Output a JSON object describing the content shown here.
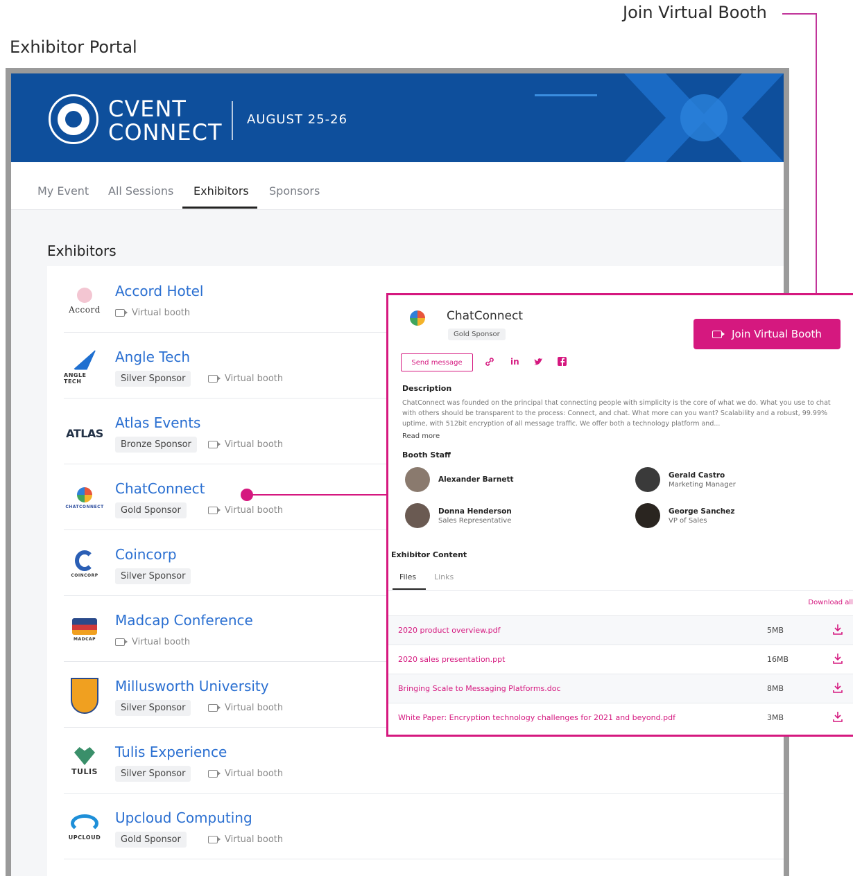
{
  "annotations": {
    "portal_title": "Exhibitor Portal",
    "callout": "Join Virtual Booth"
  },
  "banner": {
    "brand_line1": "CVENT",
    "brand_line2": "CONNECT",
    "date": "AUGUST 25-26"
  },
  "nav": {
    "tabs": [
      "My Event",
      "All Sessions",
      "Exhibitors",
      "Sponsors"
    ],
    "active": "Exhibitors"
  },
  "section_title": "Exhibitors",
  "virtual_booth_label": "Virtual booth",
  "exhibitors": [
    {
      "name": "Accord Hotel",
      "sponsor": "",
      "logo_text": "Accord",
      "color": "#d8869a"
    },
    {
      "name": "Angle Tech",
      "sponsor": "Silver Sponsor",
      "logo_text": "ANGLE TECH",
      "color": "#1e6fd0"
    },
    {
      "name": "Atlas Events",
      "sponsor": "Bronze Sponsor",
      "logo_text": "ATLAS",
      "color": "#233247"
    },
    {
      "name": "ChatConnect",
      "sponsor": "Gold Sponsor",
      "logo_text": "CHATCONNECT",
      "color": "#e8553b"
    },
    {
      "name": "Coincorp",
      "sponsor": "Silver Sponsor",
      "logo_text": "COINCORP",
      "color": "#2b5fb5"
    },
    {
      "name": "Madcap Conference",
      "sponsor": "",
      "logo_text": "MADCAP",
      "color": "#d03a3a"
    },
    {
      "name": "Millusworth University",
      "sponsor": "Silver Sponsor",
      "logo_text": "",
      "color": "#f0a020"
    },
    {
      "name": "Tulis Experience",
      "sponsor": "Silver Sponsor",
      "logo_text": "TULIS",
      "color": "#3a8f6a"
    },
    {
      "name": "Upcloud Computing",
      "sponsor": "Gold Sponsor",
      "logo_text": "UPCLOUD",
      "color": "#1e8fd8"
    }
  ],
  "panel": {
    "name": "ChatConnect",
    "badge": "Gold Sponsor",
    "join_button": "Join Virtual Booth",
    "send_message": "Send message",
    "social": [
      "link-icon",
      "linkedin-icon",
      "twitter-icon",
      "facebook-icon"
    ],
    "description_label": "Description",
    "description": "ChatConnect was founded on the principal that connecting people with simplicity is the core of what we do. What you use to chat with others should be transparent to the process: Connect, and chat. What more can you want? Scalability and a robust, 99.99% uptime, with 512bit encryption of all message traffic. We offer both a technology platform and...",
    "read_more": "Read more",
    "staff_label": "Booth Staff",
    "staff": [
      {
        "name": "Alexander Barnett",
        "title": ""
      },
      {
        "name": "Gerald Castro",
        "title": "Marketing Manager"
      },
      {
        "name": "Donna Henderson",
        "title": "Sales Representative"
      },
      {
        "name": "George Sanchez",
        "title": "VP of Sales"
      }
    ],
    "content_label": "Exhibitor Content",
    "content_tabs": [
      "Files",
      "Links"
    ],
    "download_all": "Download all",
    "files": [
      {
        "name": "2020 product overview.pdf",
        "size": "5MB"
      },
      {
        "name": "2020 sales presentation.ppt",
        "size": "16MB"
      },
      {
        "name": "Bringing Scale to Messaging Platforms.doc",
        "size": "8MB"
      },
      {
        "name": "White Paper: Encryption technology challenges for 2021 and beyond.pdf",
        "size": "3MB"
      }
    ]
  },
  "colors": {
    "banner": "#0e4f9c",
    "accent": "#d5187f",
    "link": "#2a6fd1"
  }
}
